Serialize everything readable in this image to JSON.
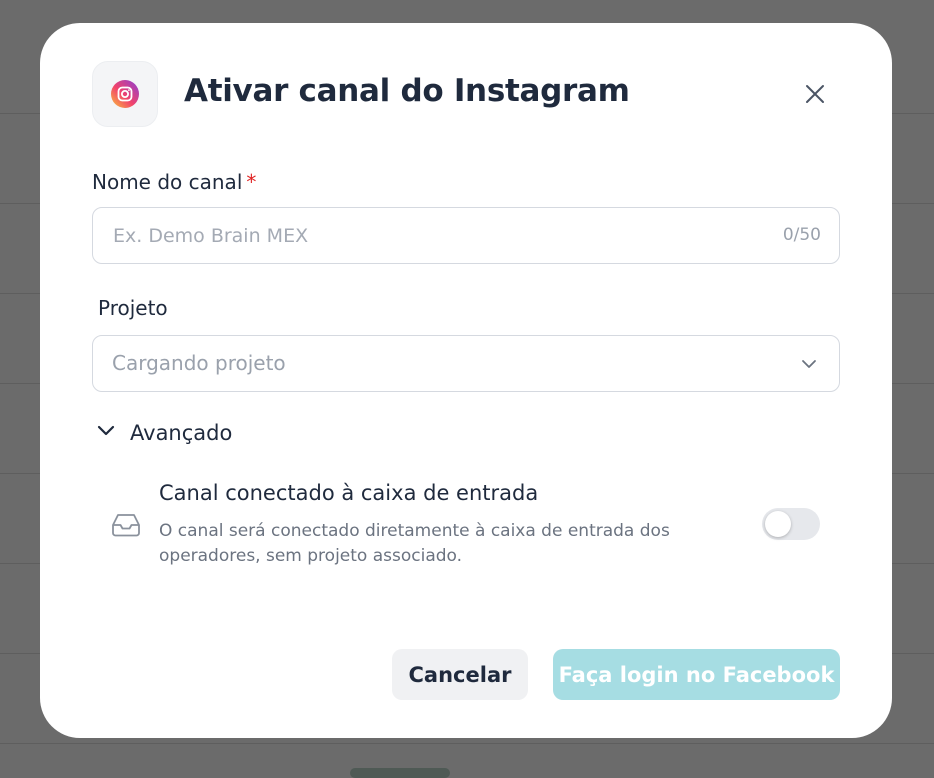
{
  "dialog": {
    "title": "Ativar canal do Instagram",
    "icon": "instagram-icon",
    "close_icon": "close-icon"
  },
  "channel_name": {
    "label": "Nome do canal",
    "required_mark": "*",
    "value": "",
    "placeholder": "Ex. Demo Brain MEX",
    "counter": "0/50"
  },
  "project": {
    "label": "Projeto",
    "selected": "Cargando projeto",
    "icon": "chevron-down-icon"
  },
  "advanced": {
    "label": "Avançado",
    "expanded": true,
    "option": {
      "icon": "inbox-icon",
      "title": "Canal conectado à caixa de entrada",
      "description": "O canal será conectado diretamente à caixa de entrada dos operadores, sem projeto associado.",
      "enabled": false
    }
  },
  "actions": {
    "cancel_label": "Cancelar",
    "facebook_login_label": "Faça login no Facebook"
  },
  "colors": {
    "primary_disabled": "#a6dde3",
    "required": "#e02424",
    "text": "#1f2a3d",
    "muted": "#6b7380"
  }
}
